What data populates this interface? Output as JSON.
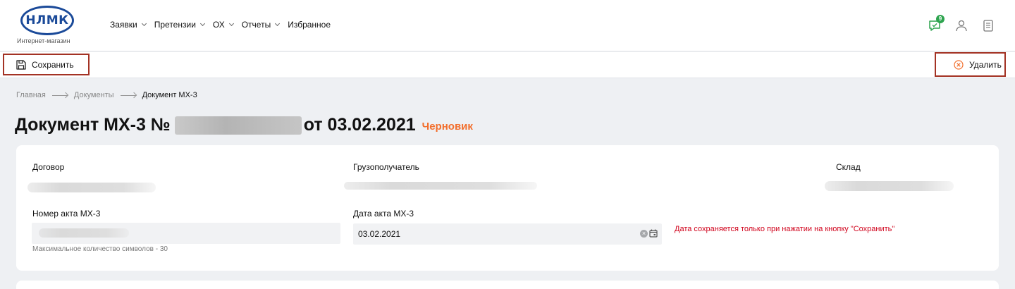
{
  "header": {
    "logo_text": "НЛМК",
    "logo_subtitle": "Интернет-магазин",
    "nav": [
      {
        "label": "Заявки",
        "has_dropdown": true
      },
      {
        "label": "Претензии",
        "has_dropdown": true
      },
      {
        "label": "ОХ",
        "has_dropdown": true
      },
      {
        "label": "Отчеты",
        "has_dropdown": true
      },
      {
        "label": "Избранное",
        "has_dropdown": false
      }
    ],
    "icons": [
      "chat-icon",
      "user-icon",
      "notebook-icon"
    ],
    "chat_badge": "9",
    "badge_color": "#2ea44f"
  },
  "toolbar": {
    "save_label": "Сохранить",
    "delete_label": "Удалить"
  },
  "breadcrumb": [
    "Главная",
    "Документы",
    "Документ МХ-3"
  ],
  "title": {
    "prefix": "Документ МХ-3 №",
    "date_text": "от 03.02.2021",
    "status": "Черновик",
    "status_color": "#f26e2c"
  },
  "form": {
    "contract_label": "Договор",
    "consignee_label": "Грузополучатель",
    "warehouse_label": "Склад",
    "act_number_label": "Номер акта МХ-3",
    "act_number_hint": "Максимальное количество символов - 30",
    "act_date_label": "Дата акта МХ-3",
    "act_date_value": "03.02.2021",
    "act_date_warning": "Дата сохраняется только при нажатии на кнопку \"Сохранить\"",
    "warning_color": "#d0021b"
  }
}
